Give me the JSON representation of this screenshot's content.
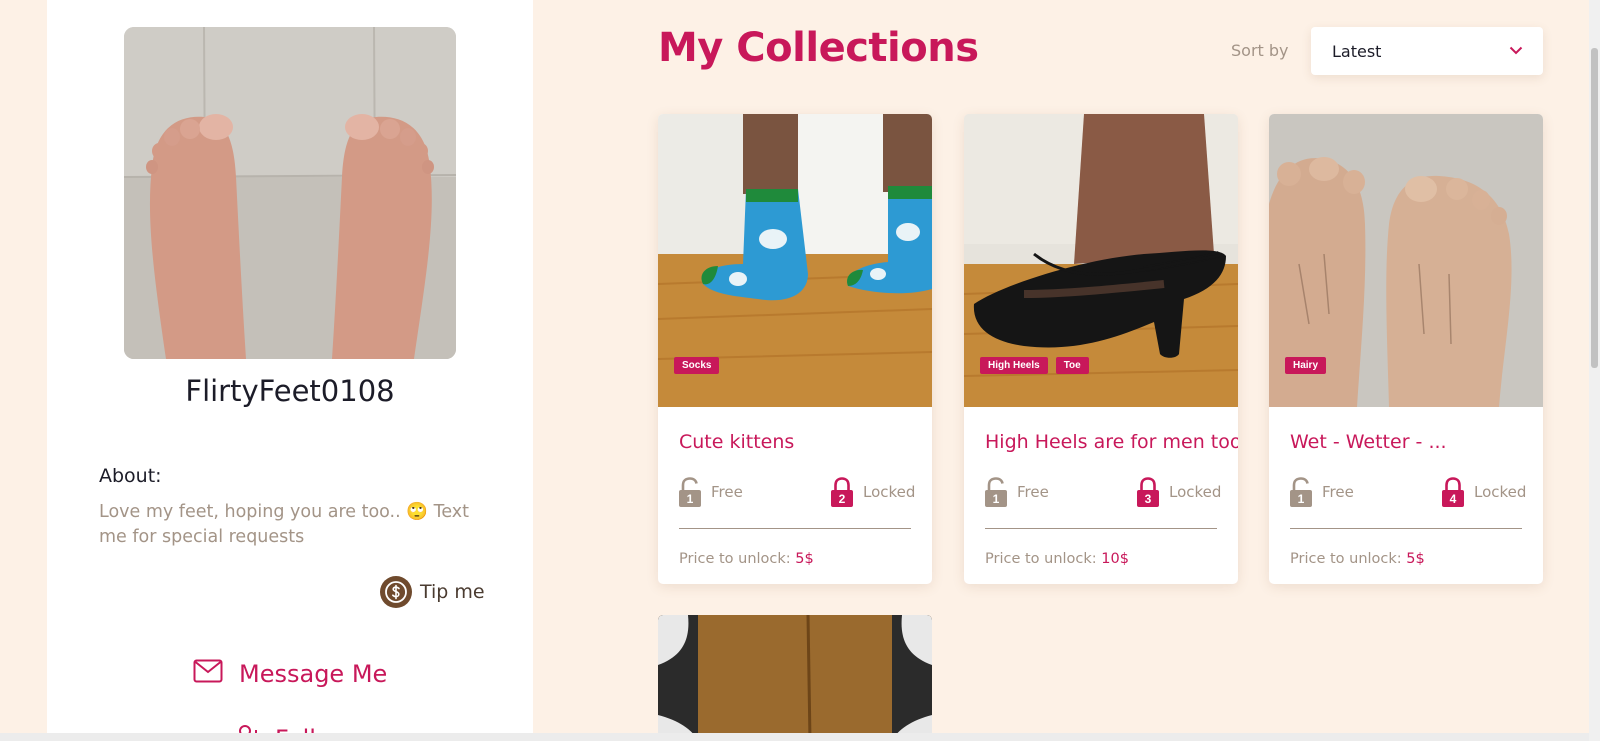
{
  "profile": {
    "username": "FlirtyFeet0108",
    "about_label": "About:",
    "about_text": "Love my feet, hoping you are too.. 🙄 Text me for special requests",
    "tip_label": "Tip me",
    "message_label": "Message Me",
    "follow_label": "Follow"
  },
  "main": {
    "title": "My Collections",
    "sort_label": "Sort by",
    "sort_value": "Latest"
  },
  "collections": [
    {
      "title": "Cute kittens",
      "tags": [
        "Socks"
      ],
      "free_count": "1",
      "free_label": "Free",
      "locked_count": "2",
      "locked_label": "Locked",
      "price_label": "Price to unlock:",
      "price_value": "5$"
    },
    {
      "title": "High Heels are for men too",
      "tags": [
        "High Heels",
        "Toe"
      ],
      "free_count": "1",
      "free_label": "Free",
      "locked_count": "3",
      "locked_label": "Locked",
      "price_label": "Price to unlock:",
      "price_value": "10$"
    },
    {
      "title": "Wet - Wetter - ...",
      "tags": [
        "Hairy"
      ],
      "free_count": "1",
      "free_label": "Free",
      "locked_count": "4",
      "locked_label": "Locked",
      "price_label": "Price to unlock:",
      "price_value": "5$"
    }
  ],
  "colors": {
    "accent": "#c8185a",
    "background": "#fdf1e6",
    "muted_text": "#a39487",
    "free_lock": "#a39487",
    "locked_lock": "#c8185a"
  },
  "icons": {
    "tip": "dollar-coin-icon",
    "message": "envelope-icon",
    "follow": "user-plus-icon",
    "sort": "chevron-down-icon",
    "free": "unlocked-padlock-icon",
    "locked": "locked-padlock-icon"
  }
}
